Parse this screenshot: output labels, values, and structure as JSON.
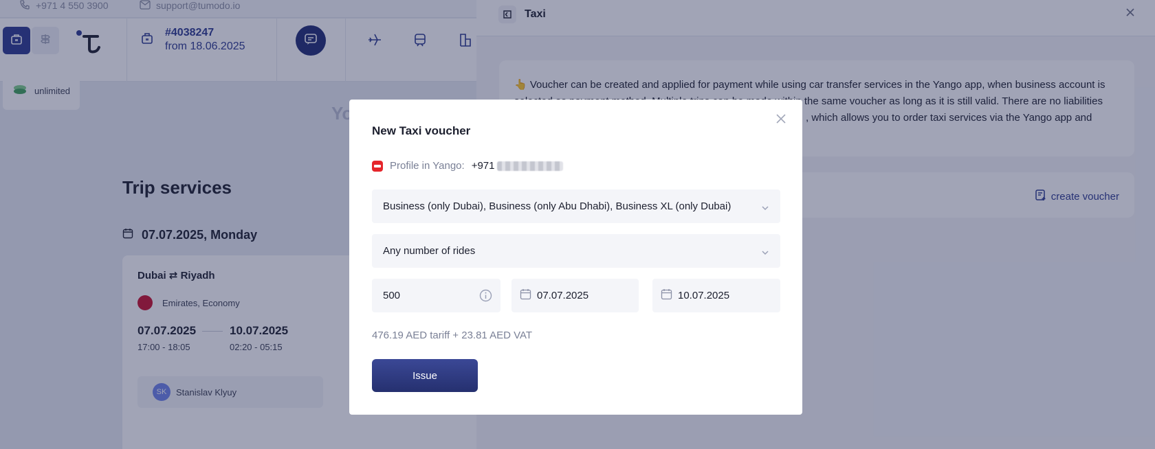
{
  "topbar": {
    "phone": "+971 4 550 3900",
    "email": "support@tumodo.io"
  },
  "header": {
    "order_number": "#4038247",
    "order_date": "from 18.06.2025"
  },
  "balance": {
    "label": "unlimited"
  },
  "background": {
    "partial_heading": "Yo"
  },
  "trip_services": {
    "title": "Trip services",
    "date": "07.07.2025, Monday",
    "card": {
      "route": "Dubai ⇄ Riyadh",
      "airline": "Emirates, Economy",
      "depart_date": "07.07.2025",
      "depart_time": "17:00 - 18:05",
      "return_date": "10.07.2025",
      "return_time": "02:20 - 05:15",
      "traveler_initials": "SK",
      "traveler_name": "Stanislav Klyuy"
    }
  },
  "panel": {
    "title": "Taxi",
    "info_line1": "Voucher can be created and applied for payment while using car transfer services in the Yango app, when business account is",
    "info_line2": "selected as payment method. Multiple trips can be made within the same voucher as long as it is still valid. There are no liabilities",
    "info_line3": ", which allows you to order taxi services via the Yango app and",
    "create_voucher": "create voucher",
    "colors": {
      "accent": "#2c3a8f"
    }
  },
  "modal": {
    "title": "New Taxi voucher",
    "profile_label": "Profile in Yango:",
    "profile_phone": "+971",
    "tariff_select": "Business (only Dubai), Business (only Abu Dhabi), Business XL (only Dubai)",
    "rides_select": "Any number of rides",
    "amount": "500",
    "date_from": "07.07.2025",
    "date_to": "10.07.2025",
    "tariff_breakdown": "476.19 AED tariff + 23.81 AED VAT",
    "issue_button": "Issue",
    "icons": [
      "close-icon",
      "yango-logo-icon",
      "chevron-down-icon",
      "info-icon",
      "calendar-icon"
    ]
  }
}
